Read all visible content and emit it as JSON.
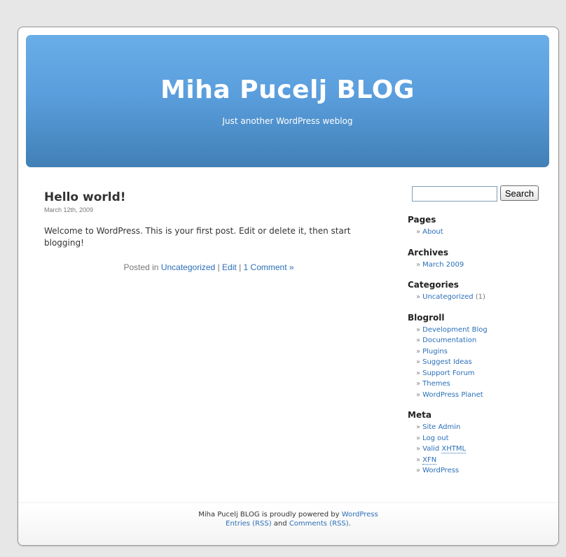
{
  "header": {
    "title": "Miha Pucelj BLOG",
    "description": "Just another WordPress weblog"
  },
  "post": {
    "title": "Hello world!",
    "date": "March 12th, 2009",
    "body": "Welcome to WordPress. This is your first post. Edit or delete it, then start blogging!",
    "meta_prefix": "Posted in",
    "category": "Uncategorized",
    "separator": "|",
    "edit": "Edit",
    "comments": "1 Comment »"
  },
  "search": {
    "value": "",
    "button": "Search"
  },
  "sidebar": {
    "raquo": "»",
    "pages": {
      "title": "Pages",
      "items": [
        "About"
      ]
    },
    "archives": {
      "title": "Archives",
      "items": [
        "March 2009"
      ]
    },
    "categories": {
      "title": "Categories",
      "items": [
        {
          "label": "Uncategorized",
          "count": "(1)"
        }
      ]
    },
    "blogroll": {
      "title": "Blogroll",
      "items": [
        "Development Blog",
        "Documentation",
        "Plugins",
        "Suggest Ideas",
        "Support Forum",
        "Themes",
        "WordPress Planet"
      ]
    },
    "meta": {
      "title": "Meta",
      "site_admin": "Site Admin",
      "log_out": "Log out",
      "valid": "Valid",
      "xhtml": "XHTML",
      "xfn": "XFN",
      "wordpress": "WordPress"
    }
  },
  "footer": {
    "powered": "Miha Pucelj BLOG is proudly powered by",
    "wordpress": "WordPress",
    "entries_rss": "Entries (RSS)",
    "and": "and",
    "comments_rss": "Comments (RSS)",
    "period": "."
  }
}
